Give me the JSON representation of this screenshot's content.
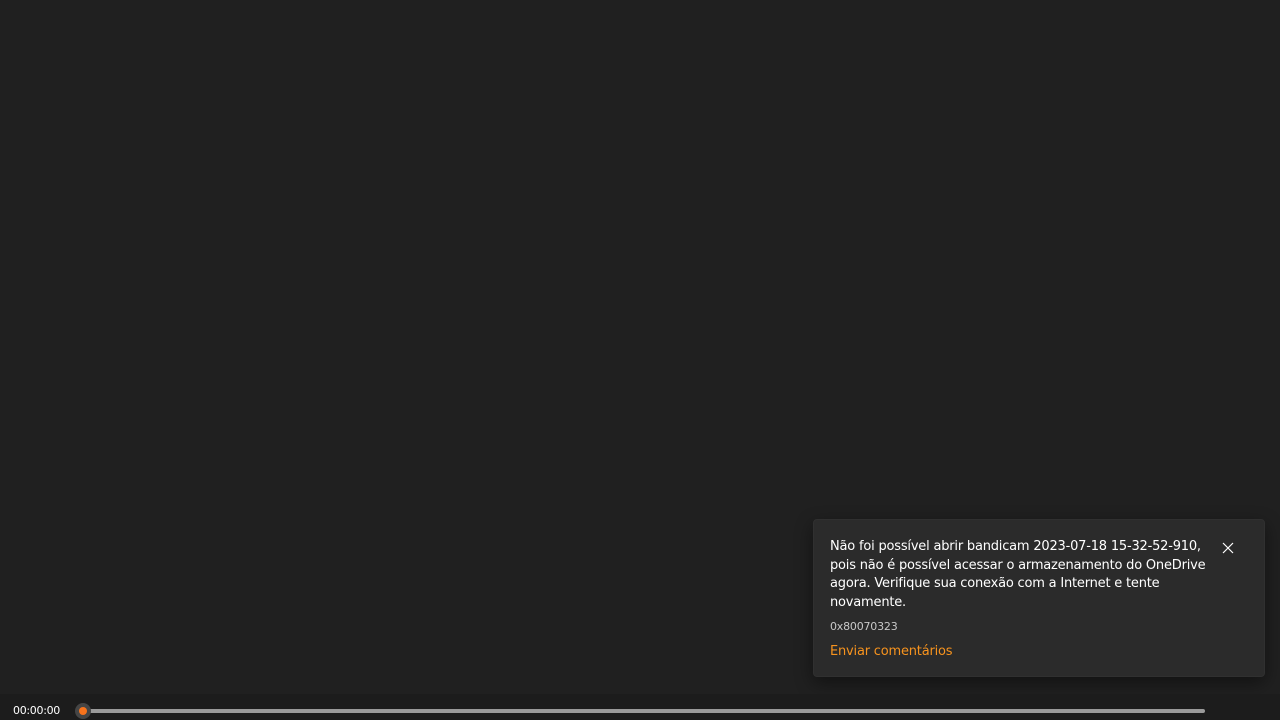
{
  "player": {
    "current_time": "00:00:00",
    "progress": 0.0
  },
  "toast": {
    "message": "Não foi possível abrir bandicam 2023-07-18 15-32-52-910, pois não é possível acessar o armazenamento do OneDrive agora. Verifique sua conexão com a Internet e tente novamente.",
    "error_code": "0x80070323",
    "feedback_link": "Enviar comentários",
    "close_icon": "close-icon"
  },
  "colors": {
    "background": "#202020",
    "accent": "#f7731c",
    "link": "#f7931e",
    "toast_background": "#2b2b2b"
  }
}
